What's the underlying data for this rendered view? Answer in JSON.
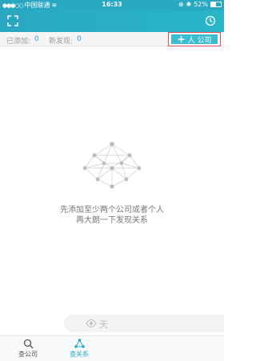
{
  "status_bar": {
    "carrier": "中国联通",
    "time": "16:33",
    "battery": "52%"
  },
  "header": {
    "scan_label": ""
  },
  "toolbar": {
    "added_label": "已添加:",
    "added_count": "0",
    "found_label": "新发现:",
    "found_count": "0",
    "add_button_label": "人 公司"
  },
  "empty_state": {
    "line1": "先添加至少两个公司或者个人",
    "line2": "再大朗一下发现关系"
  },
  "float_bar": {
    "label": "天"
  },
  "tabbar": {
    "tabs": [
      {
        "label": "查公司",
        "icon": "search-icon"
      },
      {
        "label": "查关系",
        "icon": "network-icon",
        "active": true
      }
    ]
  },
  "colors": {
    "primary": "#2aa7c2",
    "accent": "#3cbcd0",
    "highlight_border": "#e24a55"
  }
}
